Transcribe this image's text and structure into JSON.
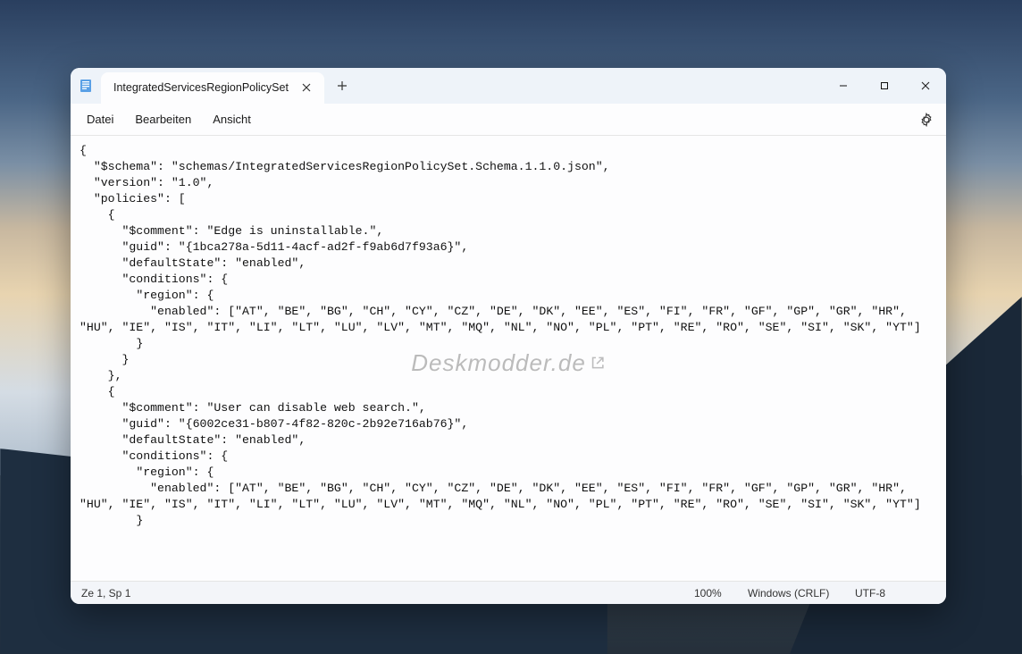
{
  "tab": {
    "title": "IntegratedServicesRegionPolicySet"
  },
  "menu": {
    "file": "Datei",
    "edit": "Bearbeiten",
    "view": "Ansicht"
  },
  "editor": {
    "content": "{\n  \"$schema\": \"schemas/IntegratedServicesRegionPolicySet.Schema.1.1.0.json\",\n  \"version\": \"1.0\",\n  \"policies\": [\n    {\n      \"$comment\": \"Edge is uninstallable.\",\n      \"guid\": \"{1bca278a-5d11-4acf-ad2f-f9ab6d7f93a6}\",\n      \"defaultState\": \"enabled\",\n      \"conditions\": {\n        \"region\": {\n          \"enabled\": [\"AT\", \"BE\", \"BG\", \"CH\", \"CY\", \"CZ\", \"DE\", \"DK\", \"EE\", \"ES\", \"FI\", \"FR\", \"GF\", \"GP\", \"GR\", \"HR\", \"HU\", \"IE\", \"IS\", \"IT\", \"LI\", \"LT\", \"LU\", \"LV\", \"MT\", \"MQ\", \"NL\", \"NO\", \"PL\", \"PT\", \"RE\", \"RO\", \"SE\", \"SI\", \"SK\", \"YT\"]\n        }\n      }\n    },\n    {\n      \"$comment\": \"User can disable web search.\",\n      \"guid\": \"{6002ce31-b807-4f82-820c-2b92e716ab76}\",\n      \"defaultState\": \"enabled\",\n      \"conditions\": {\n        \"region\": {\n          \"enabled\": [\"AT\", \"BE\", \"BG\", \"CH\", \"CY\", \"CZ\", \"DE\", \"DK\", \"EE\", \"ES\", \"FI\", \"FR\", \"GF\", \"GP\", \"GR\", \"HR\", \"HU\", \"IE\", \"IS\", \"IT\", \"LI\", \"LT\", \"LU\", \"LV\", \"MT\", \"MQ\", \"NL\", \"NO\", \"PL\", \"PT\", \"RE\", \"RO\", \"SE\", \"SI\", \"SK\", \"YT\"]\n        }\n"
  },
  "watermark": {
    "text": "Deskmodder.de"
  },
  "status": {
    "position": "Ze 1, Sp 1",
    "zoom": "100%",
    "lineending": "Windows (CRLF)",
    "encoding": "UTF-8"
  }
}
